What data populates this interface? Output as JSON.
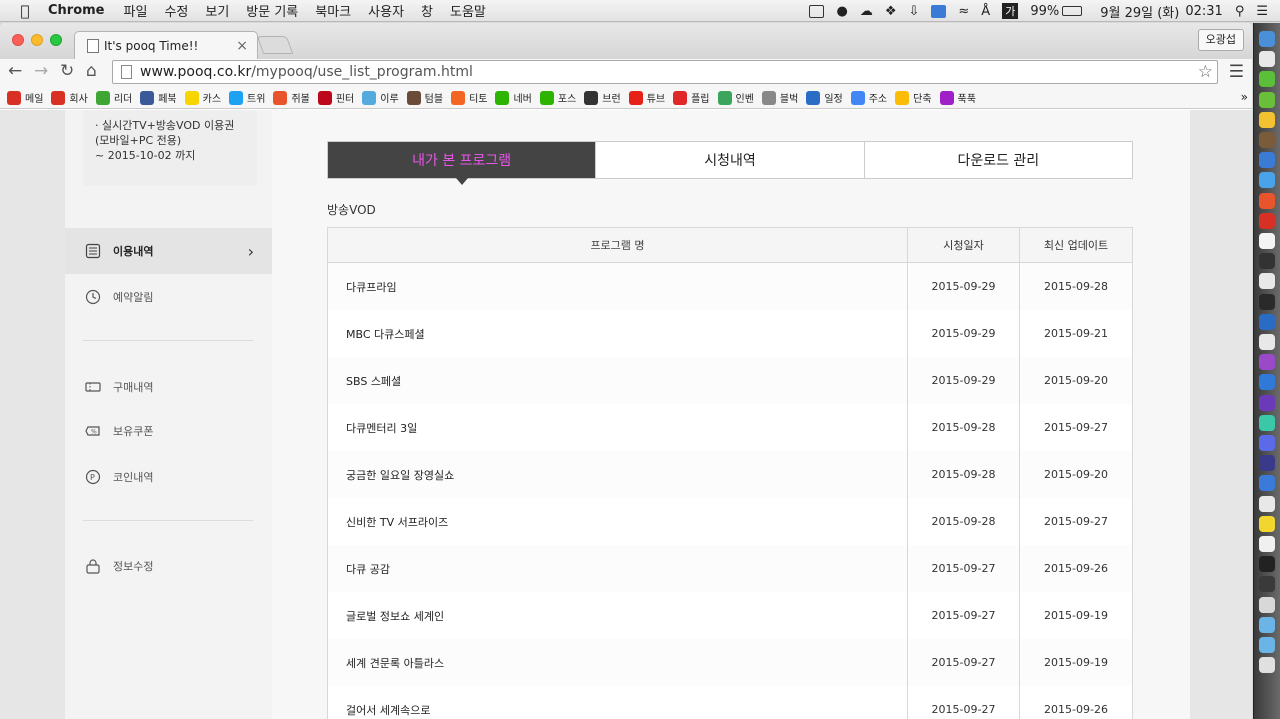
{
  "menubar": {
    "app": "Chrome",
    "items": [
      "파일",
      "수정",
      "보기",
      "방문 기록",
      "북마크",
      "사용자",
      "창",
      "도움말"
    ],
    "ime": "가",
    "battery": "99%",
    "date": "9월 29일 (화)",
    "time": "02:31"
  },
  "window": {
    "tab_title": "It's pooq Time!!",
    "profile": "오광섭",
    "url_host": "www.pooq.co.kr",
    "url_path": "/mypooq/use_list_program.html"
  },
  "bookmarks": [
    {
      "label": "메일",
      "color": "#d93025",
      "icon": "gmail-icon"
    },
    {
      "label": "회사",
      "color": "#d93025",
      "icon": "gmail-icon"
    },
    {
      "label": "리더",
      "color": "#3ea635",
      "icon": "feedly-icon"
    },
    {
      "label": "페북",
      "color": "#3b5998",
      "icon": "facebook-icon"
    },
    {
      "label": "카스",
      "color": "#f7d600",
      "icon": "kakaostory-icon"
    },
    {
      "label": "트위",
      "color": "#1da1f2",
      "icon": "twitter-icon"
    },
    {
      "label": "쥐볼",
      "color": "#e8542c",
      "icon": "google-plus-icon"
    },
    {
      "label": "핀터",
      "color": "#bd081c",
      "icon": "pinterest-icon"
    },
    {
      "label": "이루",
      "color": "#55aadd",
      "icon": "weather-icon"
    },
    {
      "label": "텀블",
      "color": "#6a4b3a",
      "icon": "avatar-icon"
    },
    {
      "label": "티토",
      "color": "#f26522",
      "icon": "tito-icon"
    },
    {
      "label": "네버",
      "color": "#2db400",
      "icon": "naver-icon"
    },
    {
      "label": "포스",
      "color": "#2db400",
      "icon": "post-icon"
    },
    {
      "label": "브런",
      "color": "#333333",
      "icon": "brunch-icon"
    },
    {
      "label": "튜브",
      "color": "#e62117",
      "icon": "youtube-icon"
    },
    {
      "label": "플립",
      "color": "#e12828",
      "icon": "flipboard-icon"
    },
    {
      "label": "인벤",
      "color": "#3ba55c",
      "icon": "inven-icon"
    },
    {
      "label": "블벅",
      "color": "#888888",
      "icon": "tumblbug-icon"
    },
    {
      "label": "일정",
      "color": "#2b6cc4",
      "icon": "calendar-icon"
    },
    {
      "label": "주소",
      "color": "#4285f4",
      "icon": "google-icon"
    },
    {
      "label": "단축",
      "color": "#fbbc05",
      "icon": "shortener-icon"
    },
    {
      "label": "푹푹",
      "color": "#a020c8",
      "icon": "pooq-icon"
    }
  ],
  "sidebar": {
    "voucher": [
      "· 실시간TV+방송VOD 이용권",
      "(모바일+PC 전용)",
      "~ 2015-10-02 까지"
    ],
    "items": [
      {
        "label": "이용내역",
        "icon": "list-icon",
        "active": true
      },
      {
        "label": "예약알림",
        "icon": "clock-icon",
        "active": false
      },
      {
        "label": "구매내역",
        "icon": "ticket-icon",
        "active": false
      },
      {
        "label": "보유쿠폰",
        "icon": "coupon-icon",
        "active": false
      },
      {
        "label": "코인내역",
        "icon": "coin-icon",
        "active": false
      },
      {
        "label": "정보수정",
        "icon": "lock-icon",
        "active": false
      }
    ]
  },
  "tabs": [
    "내가 본 프로그램",
    "시청내역",
    "다운로드 관리"
  ],
  "section_label": "방송VOD",
  "table": {
    "headers": [
      "프로그램 명",
      "시청일자",
      "최신 업데이트"
    ],
    "rows": [
      [
        "다큐프라임",
        "2015-09-29",
        "2015-09-28"
      ],
      [
        "MBC 다큐스페셜",
        "2015-09-29",
        "2015-09-21"
      ],
      [
        "SBS 스페셜",
        "2015-09-29",
        "2015-09-20"
      ],
      [
        "다큐멘터리 3일",
        "2015-09-28",
        "2015-09-27"
      ],
      [
        "궁금한 일요일 장영실쇼",
        "2015-09-28",
        "2015-09-20"
      ],
      [
        "신비한 TV 서프라이즈",
        "2015-09-28",
        "2015-09-27"
      ],
      [
        "다큐 공감",
        "2015-09-27",
        "2015-09-26"
      ],
      [
        "글로벌 정보쇼 세계인",
        "2015-09-27",
        "2015-09-19"
      ],
      [
        "세계 견문록 아틀라스",
        "2015-09-27",
        "2015-09-19"
      ],
      [
        "걸어서 세계속으로",
        "2015-09-27",
        "2015-09-26"
      ]
    ]
  }
}
